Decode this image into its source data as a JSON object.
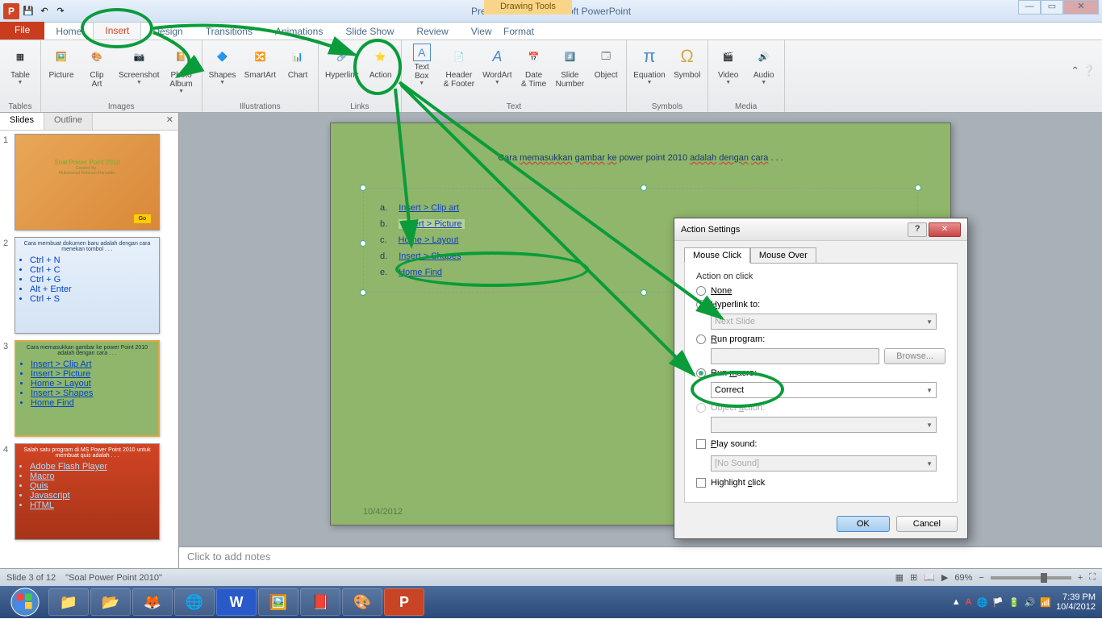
{
  "titlebar": {
    "title": "Presentation2 - Microsoft PowerPoint",
    "context": "Drawing Tools"
  },
  "tabs": {
    "file": "File",
    "home": "Home",
    "insert": "Insert",
    "design": "Design",
    "transitions": "Transitions",
    "animations": "Animations",
    "slideshow": "Slide Show",
    "review": "Review",
    "view": "View",
    "format": "Format"
  },
  "ribbon": {
    "groups": {
      "tables": "Tables",
      "images": "Images",
      "illustrations": "Illustrations",
      "links": "Links",
      "text": "Text",
      "symbols": "Symbols",
      "media": "Media"
    },
    "btns": {
      "table": "Table",
      "picture": "Picture",
      "clipart": "Clip\nArt",
      "screenshot": "Screenshot",
      "photoalbum": "Photo\nAlbum",
      "shapes": "Shapes",
      "smartart": "SmartArt",
      "chart": "Chart",
      "hyperlink": "Hyperlink",
      "action": "Action",
      "textbox": "Text\nBox",
      "headerfooter": "Header\n& Footer",
      "wordart": "WordArt",
      "datetime": "Date\n& Time",
      "slidenumber": "Slide\nNumber",
      "object": "Object",
      "equation": "Equation",
      "symbol": "Symbol",
      "video": "Video",
      "audio": "Audio"
    }
  },
  "panel": {
    "slides": "Slides",
    "outline": "Outline"
  },
  "thumbnails": [
    {
      "n": "1",
      "title": "Soal Power Point 2010",
      "sub": "Created By :\nMuhammad Rohman Irfanuddin",
      "go": "Go"
    },
    {
      "n": "2",
      "title": "Cara membuat dokumen baru adalah dengan cara menekan tombol . . .",
      "items": [
        "Ctrl + N",
        "Ctrl + C",
        "Ctrl + G",
        "Alt + Enter",
        "Ctrl + S"
      ]
    },
    {
      "n": "3",
      "title": "Cara memasukkan gambar ke power Point 2010 adalah dengan cara . . .",
      "items": [
        "Insert > Clip Art",
        "Insert > Picture",
        "Home > Layout",
        "Insert > Shapes",
        "Home Find"
      ]
    },
    {
      "n": "4",
      "title": "Salah satu program di MS Power Point 2010 untuk membuat quis adalah . . .",
      "items": [
        "Adobe Flash Player",
        "Macro",
        "Quis",
        "Javascript",
        "HTML"
      ]
    }
  ],
  "slide": {
    "title_parts": [
      "Cara ",
      "memasukkan",
      " ",
      "gambar",
      " ",
      "ke",
      " power point 2010 ",
      "adalah",
      " ",
      "dengan",
      " ",
      "cara",
      " . . ."
    ],
    "answers": [
      {
        "l": "a.",
        "t": "Insert > Clip art"
      },
      {
        "l": "b.",
        "t": "Insert > Picture",
        "sel": true
      },
      {
        "l": "c.",
        "t": "Home > Layout"
      },
      {
        "l": "d.",
        "t": "Insert > Shapes"
      },
      {
        "l": "e.",
        "t": "Home Find"
      }
    ],
    "date": "10/4/2012",
    "author": "Muhammad Rohman Irfanuddin"
  },
  "notes": "Click to add notes",
  "status": {
    "slide": "Slide 3 of 12",
    "theme": "\"Soal Power Point 2010\"",
    "zoom": "69%"
  },
  "dialog": {
    "title": "Action Settings",
    "tab1": "Mouse Click",
    "tab2": "Mouse Over",
    "legend": "Action on click",
    "none": "None",
    "hyperlink": "Hyperlink to:",
    "nextslide": "Next Slide",
    "runprog": "Run program:",
    "browse": "Browse...",
    "runmacro": "Run macro:",
    "macro_val": "Correct",
    "objaction": "Object action:",
    "playsound": "Play sound:",
    "nosound": "[No Sound]",
    "highlight": "Highlight click",
    "ok": "OK",
    "cancel": "Cancel"
  },
  "taskbar": {
    "time": "7:39 PM",
    "date": "10/4/2012"
  }
}
